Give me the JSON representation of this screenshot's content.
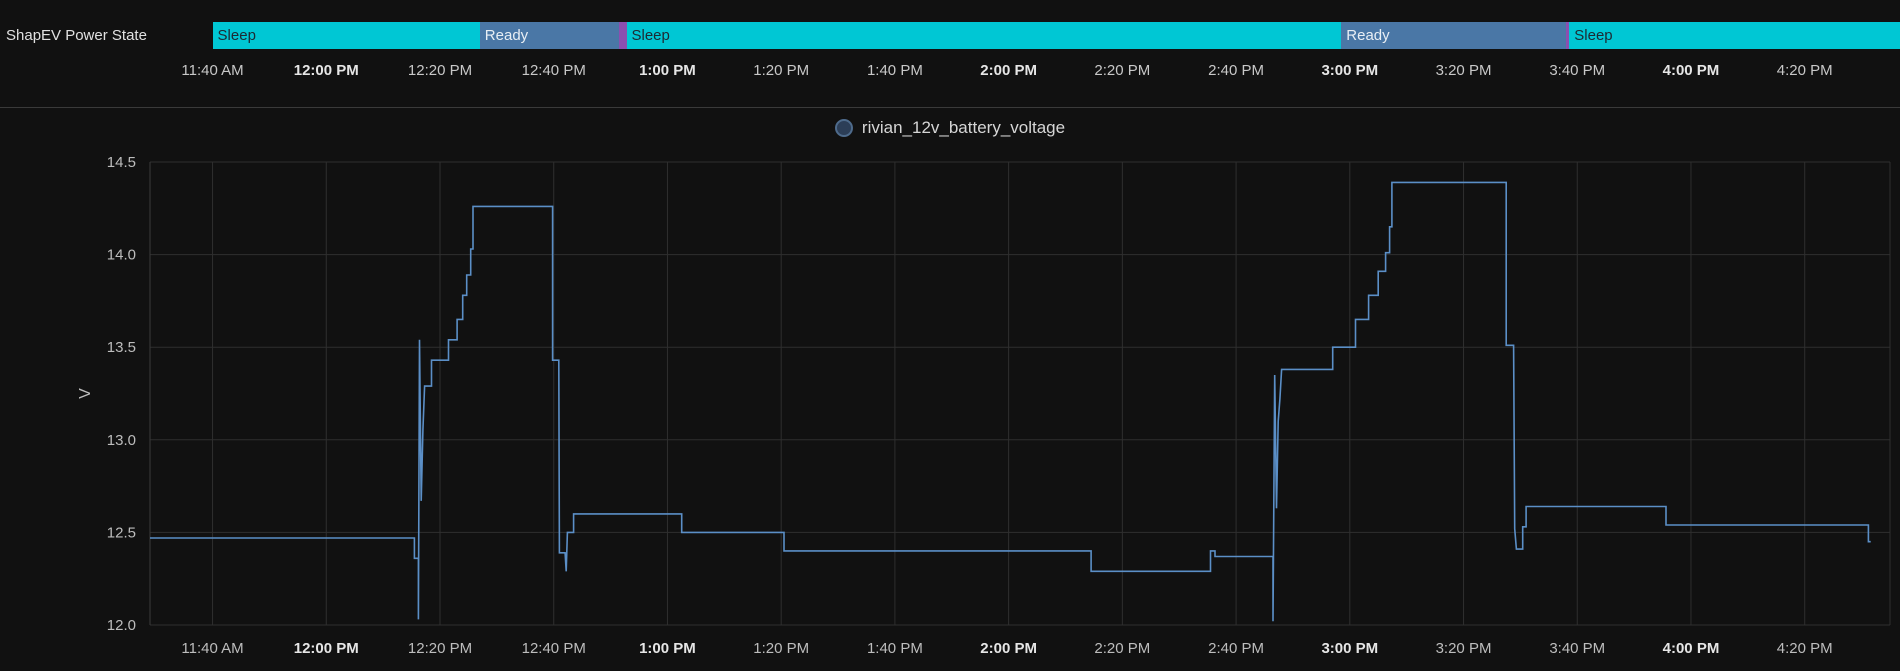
{
  "timeline": {
    "entity_label": "ShapEV Power State",
    "segments": [
      {
        "label": "Sleep",
        "state": "sleep",
        "start": 0,
        "end": 47
      },
      {
        "label": "Ready",
        "state": "ready",
        "start": 47,
        "end": 71.5
      },
      {
        "label": "",
        "state": "transition",
        "start": 71.5,
        "end": 72.8
      },
      {
        "label": "Sleep",
        "state": "sleep",
        "start": 72.8,
        "end": 198.5
      },
      {
        "label": "Ready",
        "state": "ready",
        "start": 198.5,
        "end": 238
      },
      {
        "label": "",
        "state": "transition",
        "start": 238,
        "end": 238.6
      },
      {
        "label": "Sleep",
        "state": "sleep",
        "start": 238.6,
        "end": 306
      }
    ],
    "colors": {
      "sleep": "#00c7d4",
      "ready": "#4a77a6",
      "transition": "#8b4fb0"
    }
  },
  "chart_data": {
    "type": "line",
    "title": "",
    "xlabel": "",
    "ylabel": "V",
    "x_unit": "minutes after 11:40 AM",
    "xlim": [
      -11,
      295
    ],
    "ylim": [
      12.0,
      14.5
    ],
    "yticks": [
      12.0,
      12.5,
      13.0,
      13.5,
      14.0,
      14.5
    ],
    "ytick_labels": [
      "12.0",
      "12.5",
      "13.0",
      "13.5",
      "14.0",
      "14.5"
    ],
    "xticks": [
      {
        "t": 0,
        "label": "11:40 AM",
        "bold": false
      },
      {
        "t": 20,
        "label": "12:00 PM",
        "bold": true
      },
      {
        "t": 40,
        "label": "12:20 PM",
        "bold": false
      },
      {
        "t": 60,
        "label": "12:40 PM",
        "bold": false
      },
      {
        "t": 80,
        "label": "1:00 PM",
        "bold": true
      },
      {
        "t": 100,
        "label": "1:20 PM",
        "bold": false
      },
      {
        "t": 120,
        "label": "1:40 PM",
        "bold": false
      },
      {
        "t": 140,
        "label": "2:00 PM",
        "bold": true
      },
      {
        "t": 160,
        "label": "2:20 PM",
        "bold": false
      },
      {
        "t": 180,
        "label": "2:40 PM",
        "bold": false
      },
      {
        "t": 200,
        "label": "3:00 PM",
        "bold": true
      },
      {
        "t": 220,
        "label": "3:20 PM",
        "bold": false
      },
      {
        "t": 240,
        "label": "3:40 PM",
        "bold": false
      },
      {
        "t": 260,
        "label": "4:00 PM",
        "bold": true
      },
      {
        "t": 280,
        "label": "4:20 PM",
        "bold": false
      }
    ],
    "grid": true,
    "legend_position": "top-center",
    "series": [
      {
        "name": "rivian_12v_battery_voltage",
        "color": "#5b8fc7",
        "step": true,
        "points": [
          [
            -11,
            12.47
          ],
          [
            35.5,
            12.47
          ],
          [
            35.5,
            12.36
          ],
          [
            36.2,
            12.36
          ],
          [
            36.2,
            12.03
          ],
          [
            36.4,
            13.54
          ],
          [
            36.7,
            12.67
          ],
          [
            37.0,
            13.05
          ],
          [
            37.3,
            13.29
          ],
          [
            38.5,
            13.29
          ],
          [
            38.5,
            13.43
          ],
          [
            41.5,
            13.43
          ],
          [
            41.5,
            13.54
          ],
          [
            43.0,
            13.54
          ],
          [
            43.0,
            13.65
          ],
          [
            44.0,
            13.65
          ],
          [
            44.0,
            13.78
          ],
          [
            44.7,
            13.78
          ],
          [
            44.7,
            13.89
          ],
          [
            45.4,
            13.89
          ],
          [
            45.4,
            14.03
          ],
          [
            45.8,
            14.03
          ],
          [
            45.8,
            14.26
          ],
          [
            59.8,
            14.26
          ],
          [
            59.8,
            13.43
          ],
          [
            60.9,
            13.43
          ],
          [
            61.0,
            12.39
          ],
          [
            62.0,
            12.39
          ],
          [
            62.2,
            12.29
          ],
          [
            62.4,
            12.5
          ],
          [
            63.5,
            12.5
          ],
          [
            63.5,
            12.6
          ],
          [
            82.5,
            12.6
          ],
          [
            82.5,
            12.5
          ],
          [
            100.5,
            12.5
          ],
          [
            100.5,
            12.4
          ],
          [
            154.5,
            12.4
          ],
          [
            154.5,
            12.29
          ],
          [
            175.5,
            12.29
          ],
          [
            175.5,
            12.4
          ],
          [
            176.3,
            12.4
          ],
          [
            176.3,
            12.37
          ],
          [
            186.5,
            12.37
          ],
          [
            186.5,
            12.02
          ],
          [
            186.8,
            13.35
          ],
          [
            187.1,
            12.63
          ],
          [
            187.4,
            13.1
          ],
          [
            187.7,
            13.22
          ],
          [
            188.0,
            13.38
          ],
          [
            197.0,
            13.38
          ],
          [
            197.0,
            13.5
          ],
          [
            201.0,
            13.5
          ],
          [
            201.0,
            13.65
          ],
          [
            203.3,
            13.65
          ],
          [
            203.3,
            13.78
          ],
          [
            205.0,
            13.78
          ],
          [
            205.0,
            13.91
          ],
          [
            206.3,
            13.91
          ],
          [
            206.3,
            14.01
          ],
          [
            207.0,
            14.01
          ],
          [
            207.0,
            14.15
          ],
          [
            207.4,
            14.15
          ],
          [
            207.4,
            14.39
          ],
          [
            227.5,
            14.39
          ],
          [
            227.5,
            13.51
          ],
          [
            228.8,
            13.51
          ],
          [
            229.0,
            12.52
          ],
          [
            229.3,
            12.41
          ],
          [
            230.4,
            12.41
          ],
          [
            230.4,
            12.53
          ],
          [
            231.0,
            12.53
          ],
          [
            231.0,
            12.64
          ],
          [
            255.6,
            12.64
          ],
          [
            255.6,
            12.54
          ],
          [
            291.2,
            12.54
          ],
          [
            291.2,
            12.45
          ],
          [
            291.6,
            12.45
          ]
        ]
      }
    ]
  }
}
